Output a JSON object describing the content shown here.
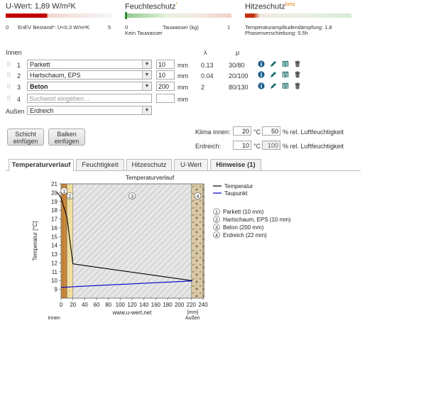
{
  "header": {
    "uwert": {
      "title": "U-Wert: 1,89 W/m²K",
      "scale_left": "0",
      "scale_mid": "EnEV Bestand*: U<0,3 W/m²K",
      "scale_right": "5",
      "bar_color": "#b00000",
      "fill_fraction": 0.378
    },
    "feuchte": {
      "title": "Feuchteschutz",
      "title_sup": "*",
      "scale_left": "0",
      "scale_mid": "Tauwasser (kg)",
      "scale_right": "1",
      "sub": "Kein Tauwasser"
    },
    "hitze": {
      "title": "Hitzeschutz",
      "title_sup": "beta",
      "line1": "Temperaturamplitudendämpfung: 1.8",
      "line2": "Phasenverschiebung: 5.5h"
    }
  },
  "layers": {
    "innen_label": "Innen",
    "col_lambda": "λ",
    "col_mu": "μ",
    "rows": [
      {
        "num": "1",
        "material": "Parkett",
        "thickness": "10",
        "unit": "mm",
        "lambda": "0.13",
        "mu": "30/80",
        "bold": false
      },
      {
        "num": "2",
        "material": "Hartschaum, EPS",
        "thickness": "10",
        "unit": "mm",
        "lambda": "0.04",
        "mu": "20/100",
        "bold": false
      },
      {
        "num": "3",
        "material": "Beton",
        "thickness": "200",
        "unit": "mm",
        "lambda": "2",
        "mu": "80/130",
        "bold": true
      }
    ],
    "new_row": {
      "num": "4",
      "placeholder": "Suchwort eingeben...",
      "unit": "mm"
    },
    "aussen_label": "Außen",
    "aussen_value": "Erdreich"
  },
  "buttons": {
    "schicht": "Schicht\neinfügen",
    "balken": "Balken\neinfügen"
  },
  "climate": {
    "innen_label": "Klima innen:",
    "innen_temp": "20",
    "innen_unit": "°C",
    "innen_rh": "50",
    "rh_label": "% rel. Luftfeuchtigkeit",
    "erdreich_label": "Erdreich:",
    "erdreich_temp": "10",
    "erdreich_unit": "°C",
    "erdreich_rh": "100",
    "rh_label2": "% rel. Luftfeuchtigkeit"
  },
  "tabs": [
    "Temperaturverlauf",
    "Feuchtigkeit",
    "Hitzeschutz",
    "U-Wert",
    "Hinweise (1)"
  ],
  "chart_data": {
    "type": "line",
    "title": "Temperaturverlauf",
    "ylabel": "Temperatur [°C]",
    "xlabel_left": "Innen",
    "xlabel_center": "www.u-wert.net",
    "xlabel_right_unit": "[mm]",
    "xlabel_right": "Außen",
    "xlim": [
      0,
      240
    ],
    "ylim": [
      8,
      21
    ],
    "xticks": [
      0,
      20,
      40,
      60,
      80,
      100,
      120,
      140,
      160,
      180,
      200,
      220,
      240
    ],
    "yticks": [
      9,
      10,
      11,
      12,
      13,
      14,
      15,
      16,
      17,
      18,
      19,
      20,
      21
    ],
    "layers": [
      {
        "num": "1",
        "label": "Parkett (10 mm)",
        "x0": 0,
        "x1": 10
      },
      {
        "num": "2",
        "label": "Hartschaum, EPS (10 mm)",
        "x0": 10,
        "x1": 20
      },
      {
        "num": "3",
        "label": "Beton (200 mm)",
        "x0": 20,
        "x1": 220
      },
      {
        "num": "4",
        "label": "Erdreich (22 mm)",
        "x0": 220,
        "x1": 242
      }
    ],
    "series": [
      {
        "name": "Temperatur",
        "color": "#000000",
        "x": [
          -8,
          -6,
          -4,
          -2,
          0,
          10,
          20,
          220,
          222
        ],
        "y": [
          20,
          19.95,
          19.8,
          19.6,
          19.4,
          17.2,
          11.9,
          10.0,
          10.0
        ]
      },
      {
        "name": "Taupunkt",
        "color": "#0000cc",
        "x": [
          0,
          10,
          20,
          220,
          222
        ],
        "y": [
          9.25,
          9.25,
          9.3,
          9.95,
          9.97
        ]
      }
    ],
    "legend_position": "top-right"
  }
}
